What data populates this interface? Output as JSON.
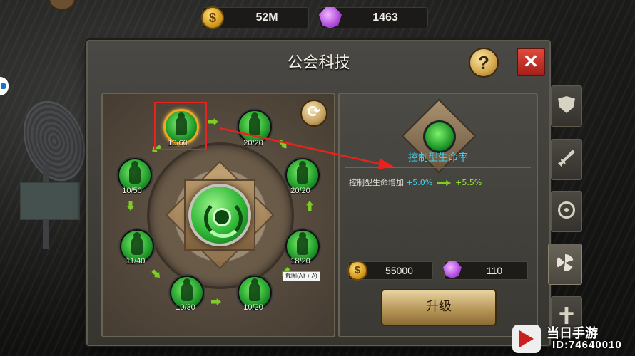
{
  "currency": {
    "gold": "52M",
    "gems": "1463"
  },
  "dialog": {
    "title": "公会科技",
    "help_label": "?",
    "close_label": "✕"
  },
  "tech_tree": {
    "refresh_label": "⟳",
    "nodes": [
      {
        "name": "biceps",
        "level": "10/60",
        "selected": true
      },
      {
        "name": "body",
        "level": "20/20"
      },
      {
        "name": "dash",
        "level": "20/20"
      },
      {
        "name": "speed",
        "level": "18/20"
      },
      {
        "name": "shadow",
        "level": "10/20"
      },
      {
        "name": "slash",
        "level": "10/30"
      },
      {
        "name": "hulk",
        "level": "11/40"
      },
      {
        "name": "claw",
        "level": "10/50"
      }
    ],
    "tooltip": "截图(Alt + A)"
  },
  "detail": {
    "name": "控制型生命率",
    "effect_label": "控制型生命增加",
    "effect_current": "+5.0%",
    "effect_next": "+5.5%",
    "cost_gold": "55000",
    "cost_gems": "110",
    "upgrade_label": "升级"
  },
  "side_tabs": [
    "shield",
    "sword",
    "target",
    "guild-tech",
    "cross"
  ],
  "watermark": {
    "name": "当日手游",
    "id": "ID:74640010"
  },
  "colors": {
    "accent_cyan": "#3fd2f0",
    "accent_green": "#9bea3a",
    "highlight_red": "#e8231f"
  }
}
